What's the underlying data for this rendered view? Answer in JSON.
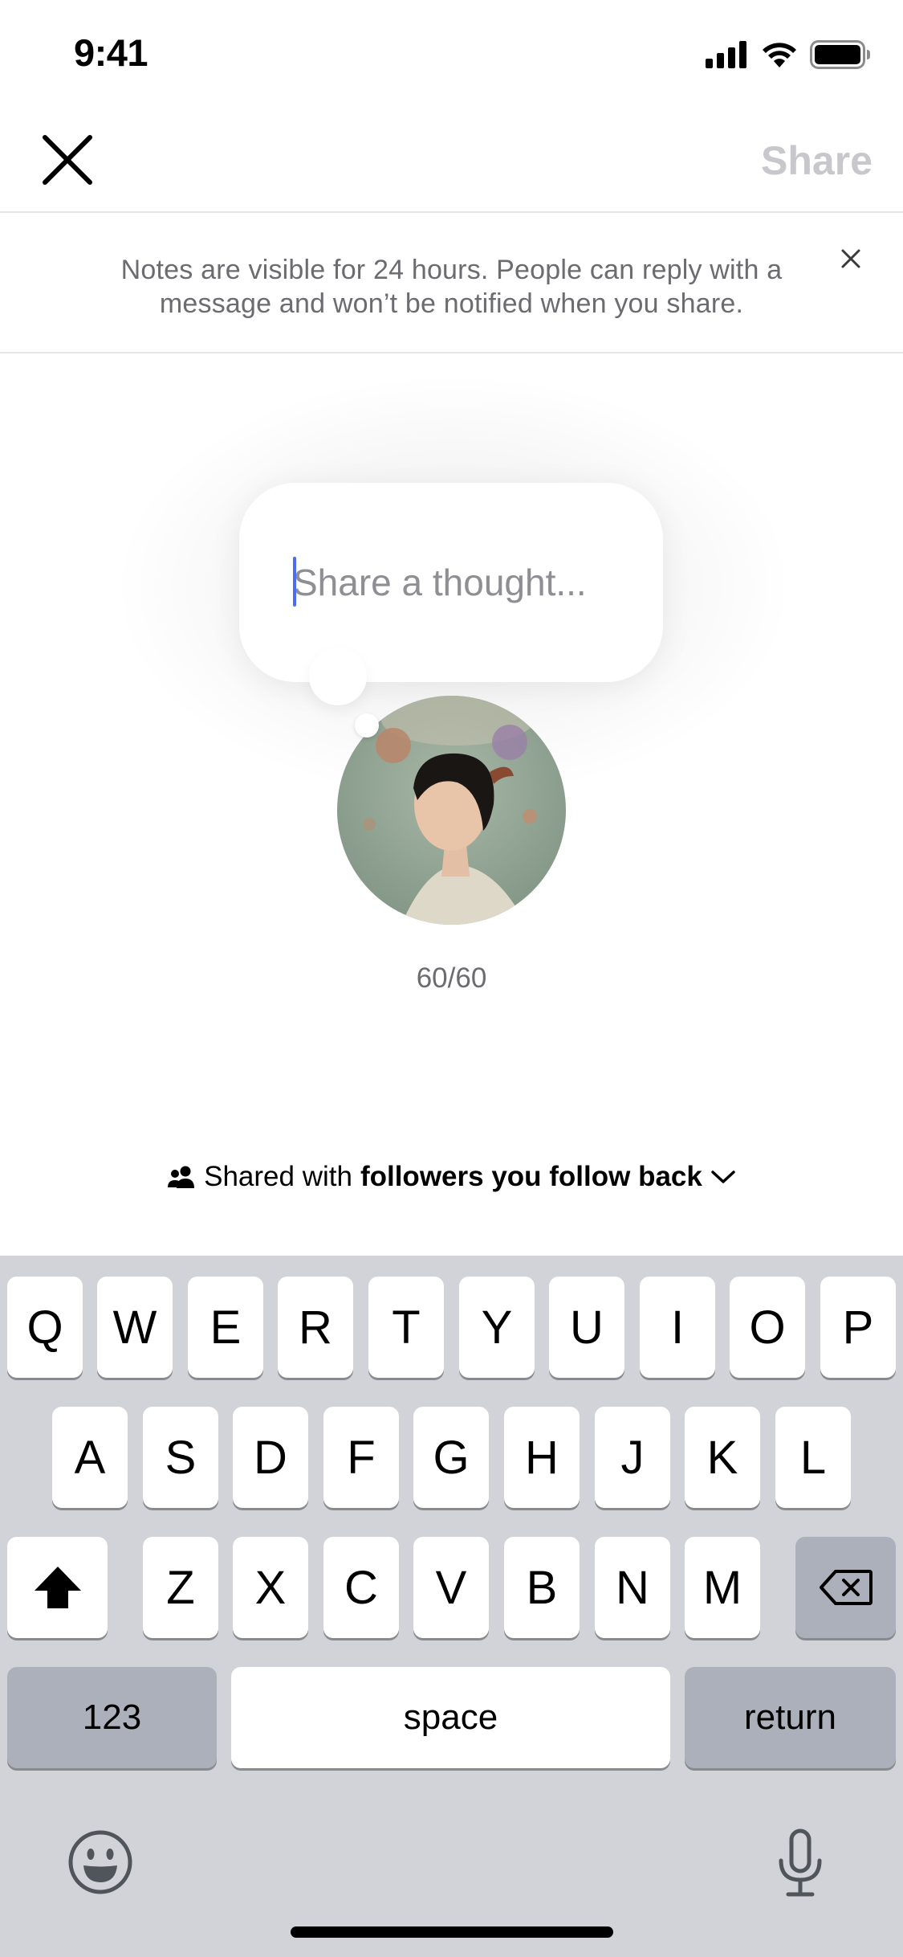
{
  "status_bar": {
    "time": "9:41",
    "icons": [
      "signal-icon",
      "wifi-icon",
      "battery-icon"
    ]
  },
  "header": {
    "close_icon": "close-icon",
    "share_label": "Share"
  },
  "banner": {
    "text": "Notes are visible for 24 hours. People can reply with a message and won’t be notified when you share.",
    "close_icon": "close-icon"
  },
  "note": {
    "placeholder": "Share a thought...",
    "value": "",
    "char_count": "60/60"
  },
  "audience": {
    "prefix": "Shared with",
    "target": "followers you follow back",
    "icon": "people-icon"
  },
  "keyboard": {
    "row1": [
      "Q",
      "W",
      "E",
      "R",
      "T",
      "Y",
      "U",
      "I",
      "O",
      "P"
    ],
    "row2": [
      "A",
      "S",
      "D",
      "F",
      "G",
      "H",
      "J",
      "K",
      "L"
    ],
    "row3": [
      "Z",
      "X",
      "C",
      "V",
      "B",
      "N",
      "M"
    ],
    "numbers_label": "123",
    "space_label": "space",
    "return_label": "return"
  },
  "colors": {
    "accent_caret": "#4a6cf7",
    "share_disabled": "#c7c7cc",
    "keyboard_bg": "#d1d3d9",
    "key_dark": "#abb0ba"
  }
}
